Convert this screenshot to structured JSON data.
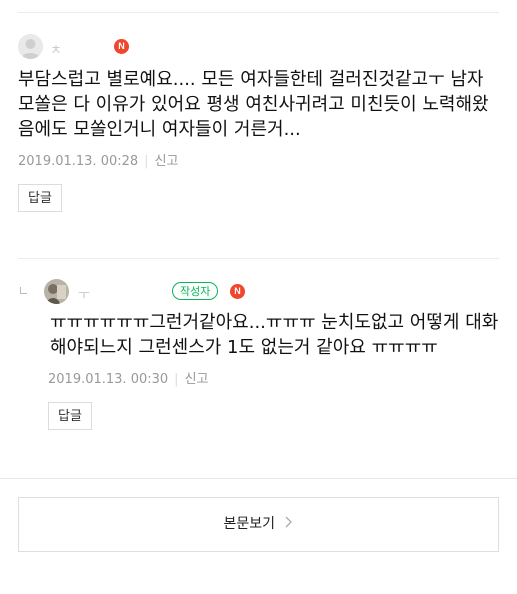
{
  "comments": [
    {
      "nickname": "ㅊ",
      "badge": "N",
      "text": "부담스럽고 별로예요.... 모든 여자들한테 걸러진것같고ㅜ 남자 모쏠은 다 이유가 있어요 평생 여친사귀려고 미친듯이 노력해왔음에도 모쏠인거니 여자들이 거른거...",
      "date": "2019.01.13. 00:28",
      "report": "신고",
      "reply_label": "답글"
    },
    {
      "nickname": "ㅜ",
      "author_badge": "작성자",
      "badge": "N",
      "text": "ㅠㅠㅠㅠㅠㅠ그런거같아요...ㅠㅠㅠ 눈치도없고 어떻게 대화해야되느지 그런센스가 1도 없는거 같아요 ㅠㅠㅠㅠ",
      "date": "2019.01.13. 00:30",
      "report": "신고",
      "reply_label": "답글"
    }
  ],
  "view_post_label": "본문보기",
  "icons": {
    "badge_color": "#f0462c",
    "author_color": "#06b65b",
    "reply_indicator": "reply-arrow-icon",
    "chevron": "chevron-right-icon"
  }
}
